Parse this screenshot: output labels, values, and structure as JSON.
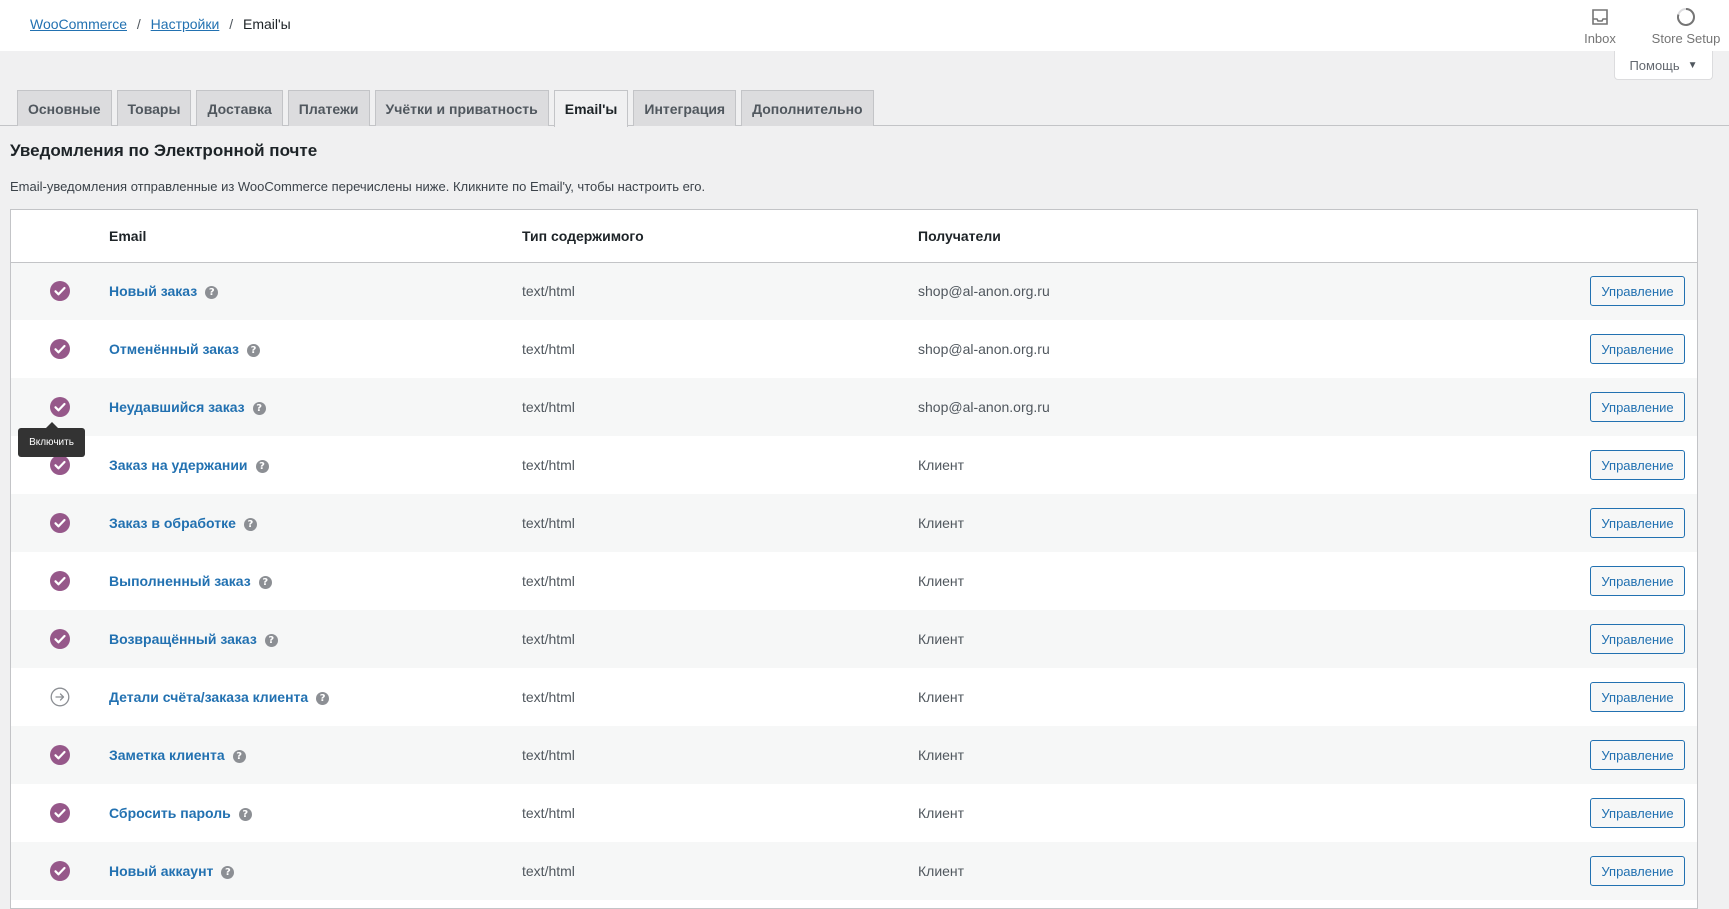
{
  "breadcrumb": {
    "items": [
      "WooCommerce",
      "Настройки"
    ],
    "current": "Email'ы",
    "separator": "/"
  },
  "top_actions": [
    {
      "label": "Inbox",
      "icon": "inbox-icon"
    },
    {
      "label": "Store Setup",
      "icon": "progress-ring-icon"
    }
  ],
  "help": {
    "label": "Помощь",
    "caret": "▼"
  },
  "tabs": [
    {
      "label": "Основные",
      "active": false
    },
    {
      "label": "Товары",
      "active": false
    },
    {
      "label": "Доставка",
      "active": false
    },
    {
      "label": "Платежи",
      "active": false
    },
    {
      "label": "Учётки и приватность",
      "active": false
    },
    {
      "label": "Email'ы",
      "active": true
    },
    {
      "label": "Интеграция",
      "active": false
    },
    {
      "label": "Дополнительно",
      "active": false
    }
  ],
  "section": {
    "title": "Уведомления по Электронной почте",
    "description": "Email-уведомления отправленные из WooCommerce перечислены ниже. Кликните по Email'у, чтобы настроить его."
  },
  "table": {
    "headers": {
      "email": "Email",
      "type": "Тип содержимого",
      "recipients": "Получатели"
    },
    "help_glyph": "?",
    "rows": [
      {
        "status": "enabled",
        "name": "Новый заказ",
        "type": "text/html",
        "recipients": "shop@al-anon.org.ru",
        "action": "Управление"
      },
      {
        "status": "enabled",
        "name": "Отменённый заказ",
        "type": "text/html",
        "recipients": "shop@al-anon.org.ru",
        "action": "Управление"
      },
      {
        "status": "enabled",
        "name": "Неудавшийся заказ",
        "type": "text/html",
        "recipients": "shop@al-anon.org.ru",
        "action": "Управление"
      },
      {
        "status": "enabled",
        "name": "Заказ на удержании",
        "type": "text/html",
        "recipients": "Клиент",
        "action": "Управление"
      },
      {
        "status": "enabled",
        "name": "Заказ в обработке",
        "type": "text/html",
        "recipients": "Клиент",
        "action": "Управление"
      },
      {
        "status": "enabled",
        "name": "Выполненный заказ",
        "type": "text/html",
        "recipients": "Клиент",
        "action": "Управление"
      },
      {
        "status": "enabled",
        "name": "Возвращённый заказ",
        "type": "text/html",
        "recipients": "Клиент",
        "action": "Управление"
      },
      {
        "status": "manual",
        "name": "Детали счёта/заказа клиента",
        "type": "text/html",
        "recipients": "Клиент",
        "action": "Управление"
      },
      {
        "status": "enabled",
        "name": "Заметка клиента",
        "type": "text/html",
        "recipients": "Клиент",
        "action": "Управление"
      },
      {
        "status": "enabled",
        "name": "Сбросить пароль",
        "type": "text/html",
        "recipients": "Клиент",
        "action": "Управление"
      },
      {
        "status": "enabled",
        "name": "Новый аккаунт",
        "type": "text/html",
        "recipients": "Клиент",
        "action": "Управление"
      }
    ]
  },
  "tooltip": {
    "text": "Включить"
  },
  "colors": {
    "enabled_icon": "#96588a",
    "link": "#2271b1",
    "manual_icon": "#8c8f94"
  }
}
